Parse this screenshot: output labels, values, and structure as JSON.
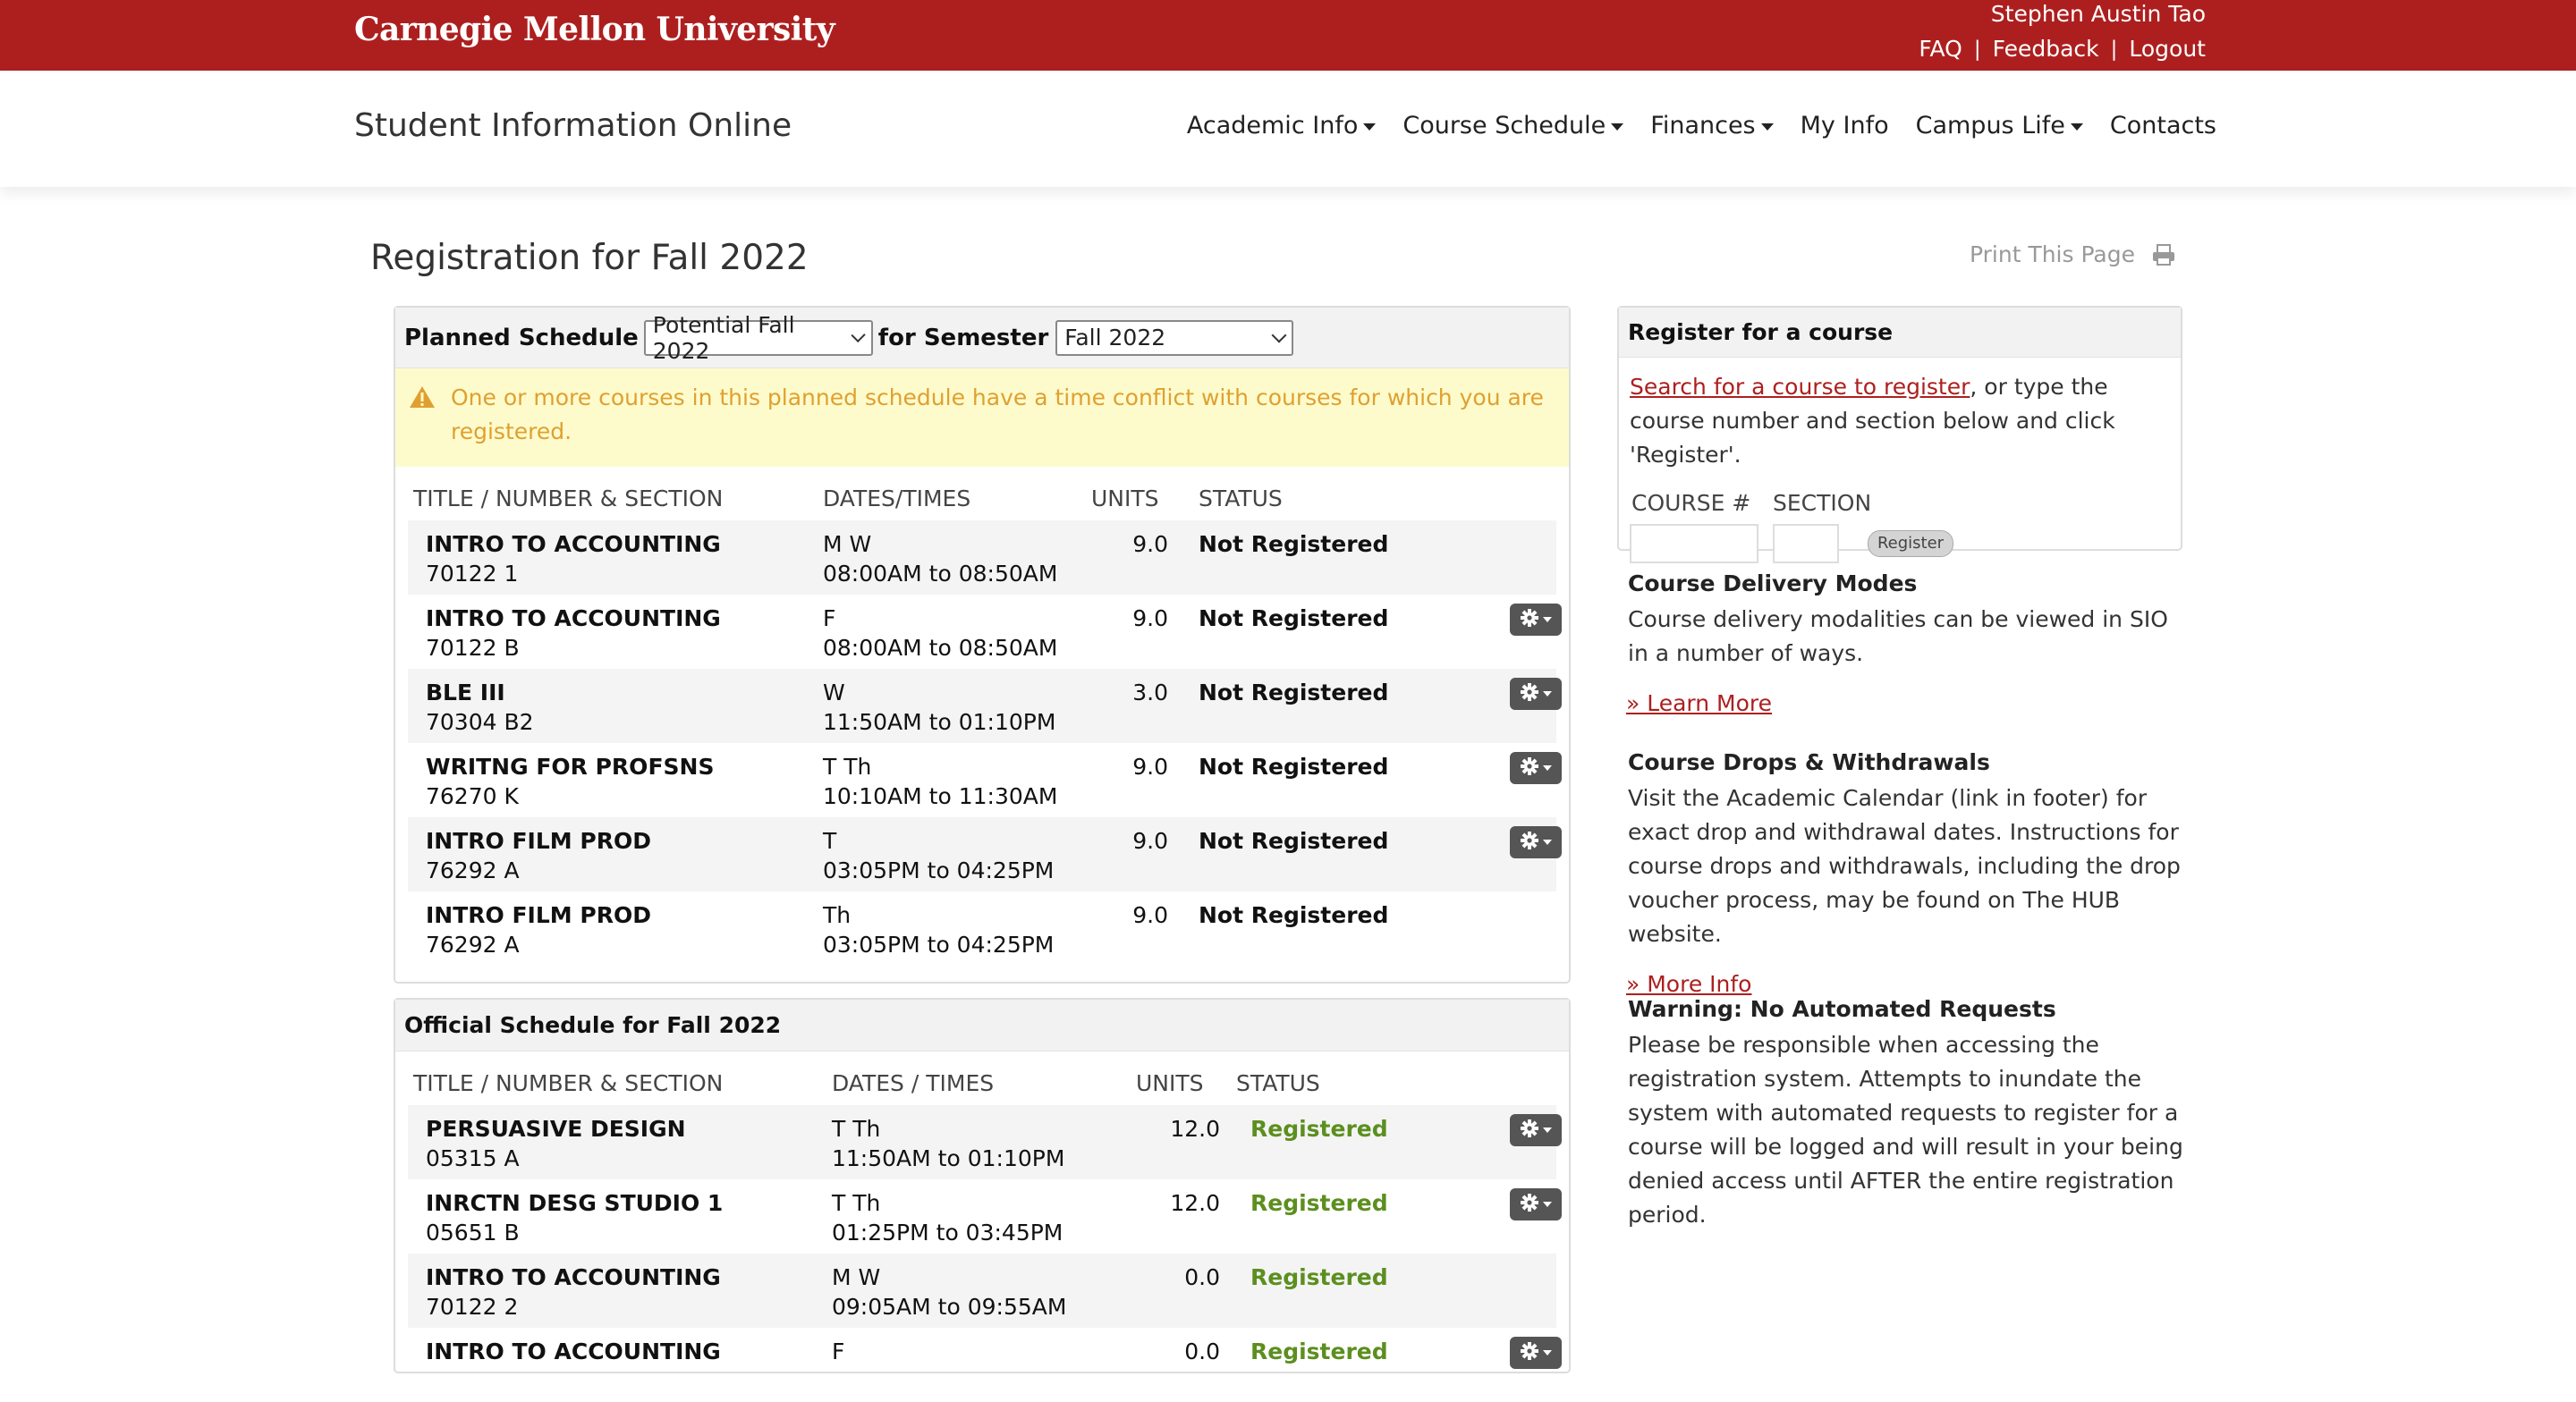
{
  "header": {
    "brand": "Carnegie Mellon University",
    "user_name": "Stephen Austin Tao",
    "links": [
      "FAQ",
      "Feedback",
      "Logout"
    ],
    "separator": "|"
  },
  "nav": {
    "site_title": "Student Information Online",
    "items": [
      {
        "label": "Academic Info",
        "dropdown": true
      },
      {
        "label": "Course Schedule",
        "dropdown": true
      },
      {
        "label": "Finances",
        "dropdown": true
      },
      {
        "label": "My Info",
        "dropdown": false
      },
      {
        "label": "Campus Life",
        "dropdown": true
      },
      {
        "label": "Contacts",
        "dropdown": false
      }
    ]
  },
  "page": {
    "title": "Registration for Fall 2022",
    "print_label": "Print This Page"
  },
  "planned": {
    "label": "Planned Schedule",
    "schedule_value": "Potential Fall 2022",
    "for_semester_label": "for Semester",
    "semester_value": "Fall 2022",
    "warning": "One or more courses in this planned schedule have a time conflict with courses for which you are registered.",
    "columns": [
      "TITLE / NUMBER & SECTION",
      "DATES/TIMES",
      "UNITS",
      "STATUS"
    ],
    "rows": [
      {
        "title": "INTRO TO ACCOUNTING",
        "number": "70122 1",
        "days": "M W",
        "times": "08:00AM to 08:50AM",
        "units": "9.0",
        "status": "Not Registered",
        "gear": false
      },
      {
        "title": "INTRO TO ACCOUNTING",
        "number": "70122 B",
        "days": "F",
        "times": "08:00AM to 08:50AM",
        "units": "9.0",
        "status": "Not Registered",
        "gear": true
      },
      {
        "title": "BLE III",
        "number": "70304 B2",
        "days": "W",
        "times": "11:50AM to 01:10PM",
        "units": "3.0",
        "status": "Not Registered",
        "gear": true
      },
      {
        "title": "WRITNG FOR PROFSNS",
        "number": "76270 K",
        "days": "T Th",
        "times": "10:10AM to 11:30AM",
        "units": "9.0",
        "status": "Not Registered",
        "gear": true
      },
      {
        "title": "INTRO FILM PROD",
        "number": "76292 A",
        "days": "T",
        "times": "03:05PM to 04:25PM",
        "units": "9.0",
        "status": "Not Registered",
        "gear": true
      },
      {
        "title": "INTRO FILM PROD",
        "number": "76292 A",
        "days": "Th",
        "times": "03:05PM to 04:25PM",
        "units": "9.0",
        "status": "Not Registered",
        "gear": false
      }
    ]
  },
  "official": {
    "title": "Official Schedule for Fall 2022",
    "columns": [
      "TITLE / NUMBER & SECTION",
      "DATES / TIMES",
      "UNITS",
      "STATUS"
    ],
    "rows": [
      {
        "title": "PERSUASIVE DESIGN",
        "number": "05315 A",
        "days": "T Th",
        "times": "11:50AM to 01:10PM",
        "units": "12.0",
        "status": "Registered",
        "gear": true
      },
      {
        "title": "INRCTN DESG STUDIO 1",
        "number": "05651 B",
        "days": "T Th",
        "times": "01:25PM to 03:45PM",
        "units": "12.0",
        "status": "Registered",
        "gear": true
      },
      {
        "title": "INTRO TO ACCOUNTING",
        "number": "70122 2",
        "days": "M W",
        "times": "09:05AM to 09:55AM",
        "units": "0.0",
        "status": "Registered",
        "gear": false
      },
      {
        "title": "INTRO TO ACCOUNTING",
        "number": "",
        "days": "F",
        "times": "",
        "units": "0.0",
        "status": "Registered",
        "gear": true
      }
    ]
  },
  "register": {
    "title": "Register for a course",
    "search_link": "Search for a course to register",
    "instructions": ", or type the course number and section below and click 'Register'.",
    "course_label": "COURSE #",
    "section_label": "SECTION",
    "button_label": "Register"
  },
  "sidebar": {
    "delivery": {
      "heading": "Course Delivery Modes",
      "text": "Course delivery modalities can be viewed in SIO in a number of ways.",
      "link": "» Learn More"
    },
    "drops": {
      "heading": "Course Drops & Withdrawals",
      "text": "Visit the Academic Calendar (link in footer) for exact drop and withdrawal dates. Instructions for course drops and withdrawals, including the drop voucher process, may be found on The HUB website.",
      "link": "» More Info"
    },
    "warning": {
      "heading": "Warning: No Automated Requests",
      "text": "Please be responsible when accessing the registration system. Attempts to inundate the system with automated requests to register for a course will be logged and will result in your being denied access until AFTER the entire registration period."
    }
  },
  "colors": {
    "brand_red": "#ad1f1f",
    "warning_bg": "#fdfbcc",
    "warning_text": "#e0a031",
    "registered_green": "#5c8f1f",
    "gear_button": "#555555"
  }
}
